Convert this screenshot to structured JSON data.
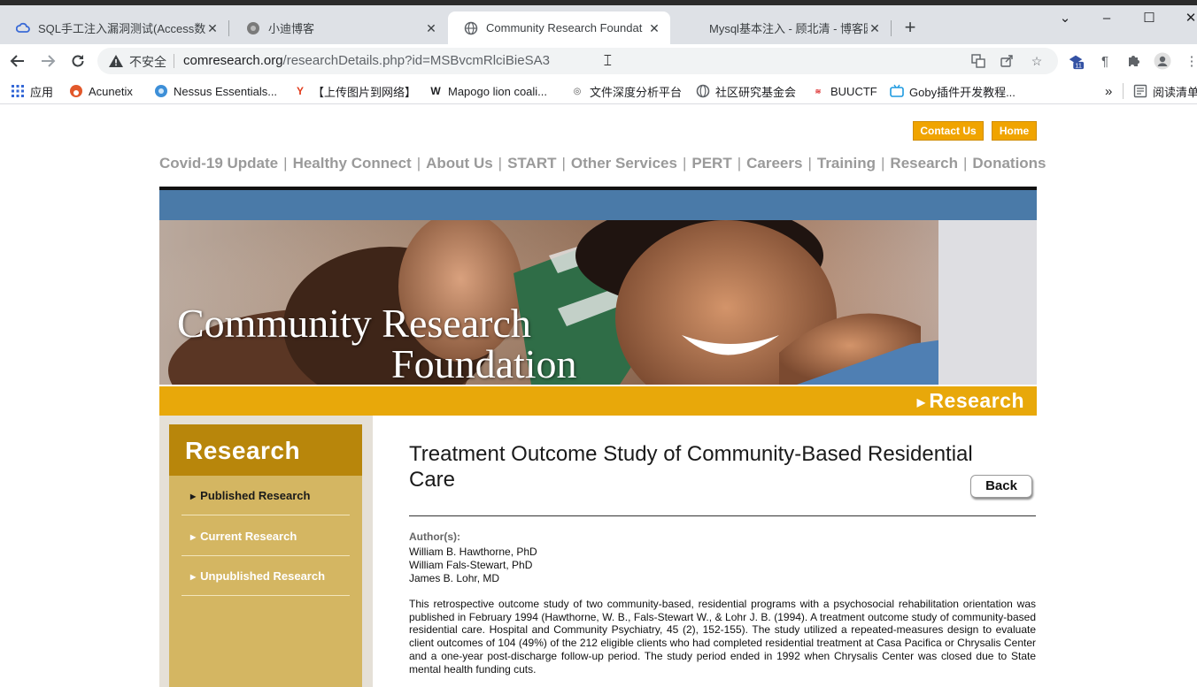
{
  "browser": {
    "tabs": [
      {
        "title": "SQL手工注入漏洞测试(Access数",
        "icon": "cloud-icon"
      },
      {
        "title": "小迪博客",
        "icon": "blog-icon"
      },
      {
        "title": "Community Research Foundat",
        "icon": "globe-icon"
      },
      {
        "title": "Mysql基本注入 - 顾北清 - 博客园",
        "icon": "blog-icon"
      }
    ],
    "window_controls": {
      "chevron": "⌄",
      "minimize": "–",
      "maximize": "☐",
      "close": "✕"
    },
    "address": {
      "security_label": "不安全",
      "url_host": "comresearch.org",
      "url_path": "/researchDetails.php?id=MSBvcmRlciBieSA3"
    },
    "extensions": {
      "badge": "11"
    },
    "bookmarks": [
      {
        "label": "应用"
      },
      {
        "label": "Acunetix"
      },
      {
        "label": "Nessus Essentials..."
      },
      {
        "label": "【上传图片到网络】"
      },
      {
        "label": "Mapogo lion coali..."
      },
      {
        "label": "文件深度分析平台"
      },
      {
        "label": "社区研究基金会"
      },
      {
        "label": "BUUCTF"
      },
      {
        "label": "Goby插件开发教程..."
      },
      {
        "label": "阅读清单"
      }
    ],
    "bookmarks_overflow": "»"
  },
  "site": {
    "top_buttons": {
      "contact": "Contact Us",
      "home": "Home"
    },
    "nav": [
      "Covid-19 Update",
      "Healthy Connect",
      "About Us",
      "START",
      "Other Services",
      "PERT",
      "Careers",
      "Training",
      "Research",
      "Donations"
    ],
    "nav_separator": "|",
    "banner": {
      "brand_line1": "Community Research",
      "brand_line2": "Foundation",
      "section_label": "Research"
    },
    "sidebar": {
      "title": "Research",
      "items": [
        {
          "label": "Published Research",
          "color": "#1a1a1a"
        },
        {
          "label": "Current Research",
          "color": "#ffffff"
        },
        {
          "label": "Unpublished Research",
          "color": "#ffffff"
        }
      ]
    },
    "article": {
      "title": "Treatment Outcome Study of Community-Based Residential Care",
      "back_label": "Back",
      "authors_label": "Author(s):",
      "authors": [
        "William B. Hawthorne, PhD",
        "William Fals-Stewart, PhD",
        "James B. Lohr, MD"
      ],
      "abstract": "This retrospective outcome study of two community-based, residential programs with a psychosocial rehabilitation orientation was published in February 1994 (Hawthorne, W. B., Fals-Stewart W., & Lohr J. B. (1994). A treatment outcome study of community-based residential care. Hospital and Community Psychiatry, 45 (2), 152-155). The study utilized a repeated-measures design to evaluate client outcomes of 104 (49%) of the 212 eligible clients who had completed residential treatment at Casa Pacifica or Chrysalis Center and a one-year post-discharge follow-up period. The study period ended in 1992 when Chrysalis Center was closed due to State mental health funding cuts."
    },
    "colors": {
      "accent_gold": "#e8a80a",
      "banner_blue": "#4a7aa8",
      "sidebar_dark": "#b8860b",
      "sidebar_light": "#d4b662",
      "nav_gray": "#9a9a9a"
    }
  }
}
